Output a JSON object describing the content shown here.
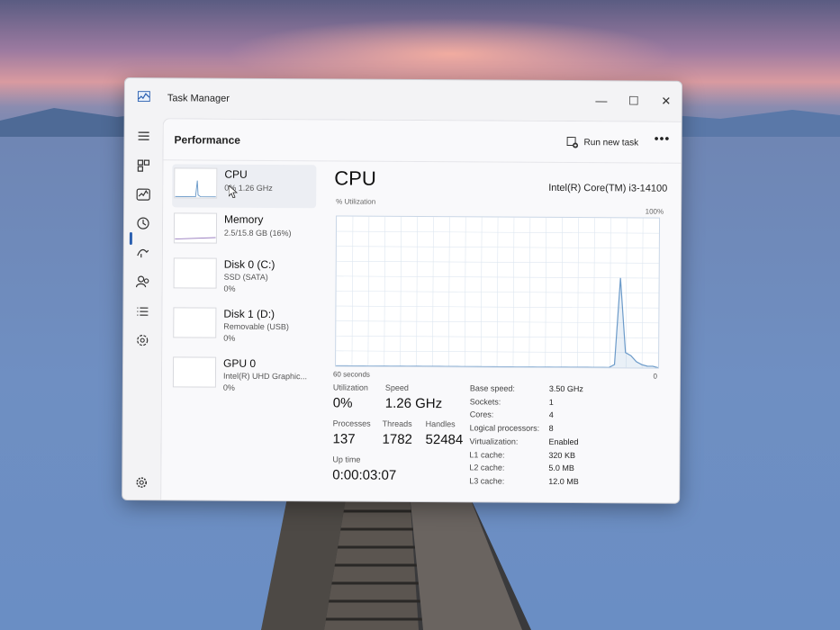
{
  "window": {
    "title": "Task Manager",
    "controls": {
      "minimize": "—",
      "maximize": "☐",
      "close": "✕"
    }
  },
  "nav": {
    "items": [
      "menu-icon",
      "processes-icon",
      "performance-icon",
      "app-history-icon",
      "startup-apps-icon",
      "users-icon",
      "details-icon",
      "services-icon",
      "settings-icon"
    ],
    "active": "performance-icon"
  },
  "header": {
    "page_title": "Performance",
    "run_new_task": "Run new task",
    "more": "•••"
  },
  "resources": [
    {
      "name": "CPU",
      "sub1": "0%  1.26 GHz"
    },
    {
      "name": "Memory",
      "sub1": "2.5/15.8 GB (16%)"
    },
    {
      "name": "Disk 0 (C:)",
      "sub1": "SSD (SATA)",
      "sub2": "0%"
    },
    {
      "name": "Disk 1 (D:)",
      "sub1": "Removable (USB)",
      "sub2": "0%"
    },
    {
      "name": "GPU 0",
      "sub1": "Intel(R) UHD Graphic...",
      "sub2": "0%"
    }
  ],
  "detail": {
    "title": "CPU",
    "model": "Intel(R) Core(TM) i3-14100",
    "util_label": "% Utilization",
    "max_label": "100%",
    "time_label": "60 seconds",
    "min_label": "0",
    "graph_values": [
      0,
      0,
      0,
      0,
      0,
      0,
      0,
      0,
      0,
      0,
      0,
      0,
      0,
      0,
      0,
      0,
      0,
      0,
      0,
      0,
      0,
      0,
      0,
      0,
      0,
      0,
      0,
      0,
      0,
      0,
      0,
      0,
      0,
      0,
      0,
      0,
      0,
      0,
      0,
      0,
      0,
      0,
      0,
      0,
      0,
      0,
      0,
      0,
      0,
      0,
      0,
      2,
      60,
      10,
      8,
      4,
      2,
      1,
      1,
      0
    ],
    "stats": {
      "utilization_label": "Utilization",
      "utilization": "0%",
      "speed_label": "Speed",
      "speed": "1.26 GHz",
      "processes_label": "Processes",
      "processes": "137",
      "threads_label": "Threads",
      "threads": "1782",
      "handles_label": "Handles",
      "handles": "52484",
      "uptime_label": "Up time",
      "uptime": "0:00:03:07"
    },
    "specs": [
      {
        "k": "Base speed:",
        "v": "3.50 GHz"
      },
      {
        "k": "Sockets:",
        "v": "1"
      },
      {
        "k": "Cores:",
        "v": "4"
      },
      {
        "k": "Logical processors:",
        "v": "8"
      },
      {
        "k": "Virtualization:",
        "v": "Enabled"
      },
      {
        "k": "L1 cache:",
        "v": "320 KB"
      },
      {
        "k": "L2 cache:",
        "v": "5.0 MB"
      },
      {
        "k": "L3 cache:",
        "v": "12.0 MB"
      }
    ]
  },
  "colors": {
    "accent": "#2a5fb0",
    "graph_line": "#6b9ac9",
    "graph_grid": "#dde6f0"
  }
}
